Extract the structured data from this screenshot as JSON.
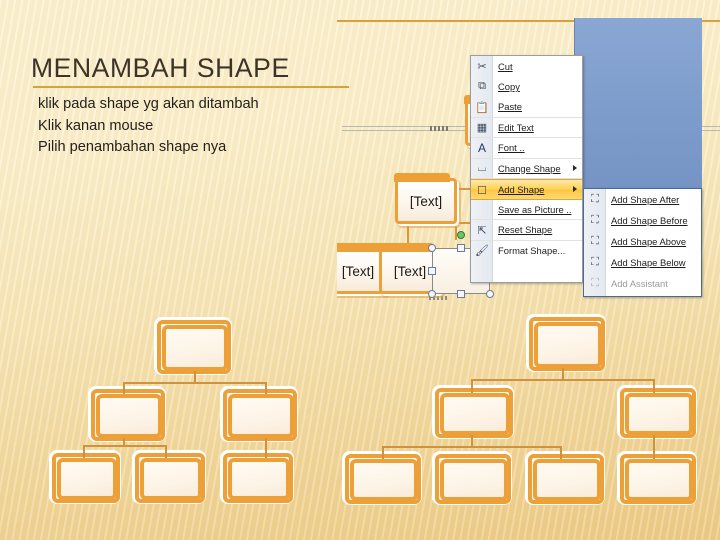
{
  "slide": {
    "title": "MENAMBAH SHAPE",
    "body_lines": [
      "klik pada shape yg akan ditambah",
      "Klik kanan mouse",
      "Pilih penambahan shape nya"
    ],
    "accent_color": "#d8a13c",
    "shape_color": "#eda037",
    "background_color": "#f7e6b8"
  },
  "context_menu": {
    "items": [
      {
        "label": "Cut",
        "icon": "scissors-icon",
        "accel": "t",
        "submenu": false,
        "disabled": false
      },
      {
        "label": "Copy",
        "icon": "copy-icon",
        "accel": "o",
        "submenu": false,
        "disabled": false
      },
      {
        "label": "Paste",
        "icon": "paste-icon",
        "accel": "P",
        "submenu": false,
        "disabled": false
      },
      {
        "label": "Edit Text",
        "icon": "edit-text-icon",
        "accel": "x",
        "submenu": false,
        "disabled": false
      },
      {
        "label": "Font ..",
        "icon": "font-icon",
        "accel": "o",
        "submenu": false,
        "disabled": false
      },
      {
        "label": "Change Shape",
        "icon": "change-shape-icon",
        "accel": "n",
        "submenu": true,
        "disabled": false
      },
      {
        "label": "Add Shape",
        "icon": "add-shape-icon",
        "accel": "A",
        "submenu": true,
        "disabled": false,
        "highlighted": true
      },
      {
        "label": "Save as Picture ..",
        "icon": "save-picture-icon",
        "accel": "S",
        "submenu": false,
        "disabled": false
      },
      {
        "label": "Reset Shape",
        "icon": "reset-shape-icon",
        "accel": "R",
        "submenu": false,
        "disabled": false
      },
      {
        "label": "Format Shape...",
        "icon": "format-shape-icon",
        "accel": "",
        "submenu": false,
        "disabled": false
      }
    ],
    "highlight_color": "#ffc63b"
  },
  "submenu": {
    "items": [
      {
        "label": "Add Shape After",
        "icon": "add-shape-after-icon",
        "disabled": false
      },
      {
        "label": "Add Shape Before",
        "icon": "add-shape-before-icon",
        "disabled": false
      },
      {
        "label": "Add Shape Above",
        "icon": "add-shape-above-icon",
        "disabled": false
      },
      {
        "label": "Add Shape Below",
        "icon": "add-shape-below-icon",
        "disabled": false
      },
      {
        "label": "Add Assistant",
        "icon": "add-assistant-icon",
        "disabled": true
      }
    ]
  },
  "smartart": {
    "placeholder": "[Text]",
    "nodes": [
      {
        "id": "top",
        "label": "[Text]"
      },
      {
        "id": "mid",
        "label": "[Text]"
      },
      {
        "id": "leaf1",
        "label": "[Text]"
      },
      {
        "id": "leaf2",
        "label": "[Text]"
      },
      {
        "id": "leaf3",
        "label": ""
      }
    ],
    "selected_node": "leaf3"
  },
  "org_chart_left": {
    "rows": [
      {
        "nodes": [
          ""
        ]
      },
      {
        "nodes": [
          "",
          ""
        ]
      },
      {
        "nodes": [
          "",
          "",
          ""
        ]
      }
    ]
  },
  "org_chart_right": {
    "rows": [
      {
        "nodes": [
          ""
        ]
      },
      {
        "nodes": [
          "",
          ""
        ]
      },
      {
        "nodes": [
          "",
          "",
          "",
          ""
        ]
      }
    ]
  }
}
